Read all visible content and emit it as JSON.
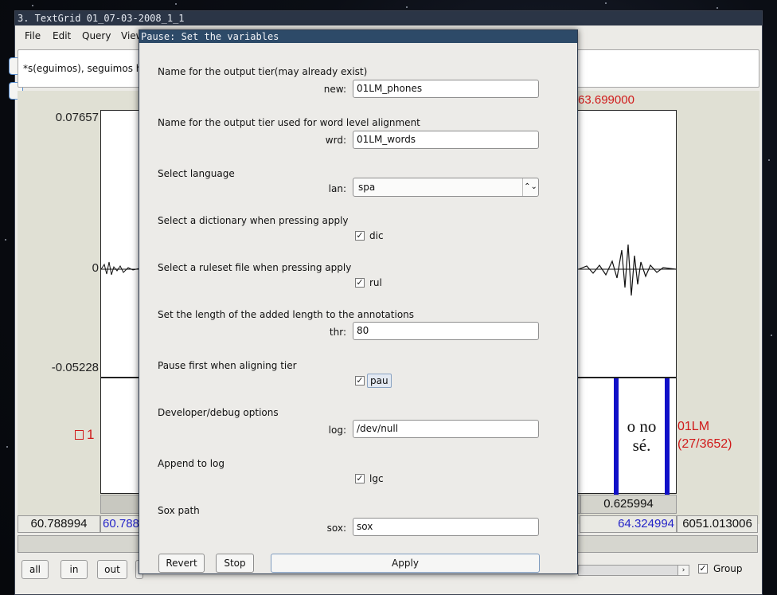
{
  "background_window": {
    "title": "3. TextGrid 01_07-03-2008_1_1",
    "menu": [
      "File",
      "Edit",
      "Query",
      "View"
    ],
    "transcript_text": "*s(eguimos), seguimos ha",
    "scale": {
      "top": "0.07657",
      "zero": "0",
      "bottom": "-0.05228"
    },
    "cursor_time": "63.699000",
    "tier_number": "1",
    "tier_name": "01LM",
    "tier_count": "(27/3652)",
    "interval_text": "o no sé.",
    "interval_duration": "0.625994",
    "bottom": {
      "left_time": "60.788994",
      "visible_start": "60.788",
      "visible_end": "64.324994",
      "total_end": "6051.013006"
    },
    "buttons": {
      "all": "all",
      "in": "in",
      "out": "out"
    },
    "group_label": "Group",
    "group_checked": true
  },
  "dialog": {
    "title": "Pause: Set the variables",
    "fields": [
      {
        "label": "Name for the output tier(may already exist)",
        "key": "new:",
        "type": "text",
        "value": "01LM_phones"
      },
      {
        "label": "Name for the output tier used for word level alignment",
        "key": "wrd:",
        "type": "text",
        "value": "01LM_words"
      },
      {
        "label": "Select language",
        "key": "lan:",
        "type": "select",
        "value": "spa"
      },
      {
        "label": "Select a dictionary when pressing apply",
        "key": "",
        "type": "checkbox",
        "value": "dic",
        "checked": true
      },
      {
        "label": "Select a ruleset file when pressing apply",
        "key": "",
        "type": "checkbox",
        "value": "rul",
        "checked": true
      },
      {
        "label": "Set the length of the added length to the annotations",
        "key": "thr:",
        "type": "text",
        "value": "80"
      },
      {
        "label": "Pause first when aligning tier",
        "key": "",
        "type": "checkbox",
        "value": "pau",
        "checked": true
      },
      {
        "label": "Developer/debug options",
        "key": "log:",
        "type": "text",
        "value": "/dev/null"
      },
      {
        "label": "Append to log",
        "key": "",
        "type": "checkbox",
        "value": "lgc",
        "checked": true
      },
      {
        "label": "Sox path",
        "key": "sox:",
        "type": "text",
        "value": "sox"
      }
    ],
    "buttons": {
      "revert": "Revert",
      "stop": "Stop",
      "apply": "Apply"
    }
  },
  "colors": {
    "dialog_title_bg": "#2d4a68",
    "window_title_bg": "#2b3546",
    "red_text": "#d01a1a",
    "blue_text": "#2525c8"
  }
}
